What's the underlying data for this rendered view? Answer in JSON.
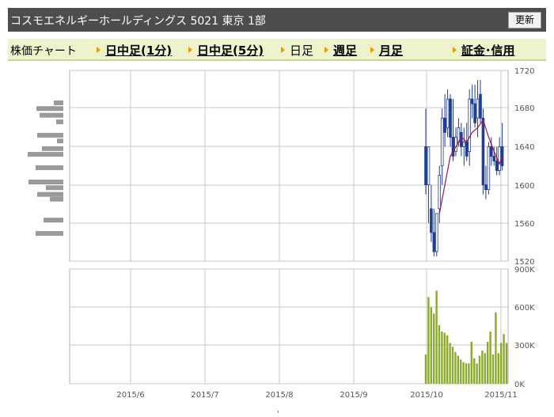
{
  "header": {
    "title": "コスモエネルギーホールディングス 5021 東京 1部",
    "refresh_label": "更新"
  },
  "nav": {
    "label": "株価チャート",
    "items": [
      {
        "label": "日中足(1分)",
        "link": true
      },
      {
        "label": "日中足(5分)",
        "link": true
      },
      {
        "label": "日足",
        "link": false
      },
      {
        "label": "週足",
        "link": true
      },
      {
        "label": "月足",
        "link": true
      },
      {
        "label": "証金･信用",
        "link": true
      }
    ]
  },
  "colors": {
    "candle": "#1f3c99",
    "moving_average": "#a0174f",
    "volume": "#8cab2d",
    "volume_profile": "#9a9a9a",
    "grid": "#c8c8c8"
  },
  "chart_data": [
    {
      "type": "candlestick",
      "x_ticks": [
        "2015/6",
        "2015/7",
        "2015/8",
        "2015/9",
        "2015/10",
        "2015/11"
      ],
      "y_ticks": [
        "1720",
        "1680",
        "1640",
        "1600",
        "1560",
        "1520"
      ],
      "ylim": [
        1520,
        1720
      ],
      "candles": [
        {
          "o": 1640,
          "h": 1680,
          "l": 1590,
          "c": 1600
        },
        {
          "o": 1600,
          "h": 1640,
          "l": 1560,
          "c": 1640
        },
        {
          "o": 1575,
          "h": 1600,
          "l": 1540,
          "c": 1550
        },
        {
          "o": 1550,
          "h": 1575,
          "l": 1525,
          "c": 1530
        },
        {
          "o": 1530,
          "h": 1570,
          "l": 1525,
          "c": 1570
        },
        {
          "o": 1575,
          "h": 1620,
          "l": 1560,
          "c": 1610
        },
        {
          "o": 1620,
          "h": 1680,
          "l": 1600,
          "c": 1670
        },
        {
          "o": 1670,
          "h": 1695,
          "l": 1640,
          "c": 1655
        },
        {
          "o": 1660,
          "h": 1700,
          "l": 1650,
          "c": 1690
        },
        {
          "o": 1690,
          "h": 1695,
          "l": 1640,
          "c": 1650
        },
        {
          "o": 1650,
          "h": 1690,
          "l": 1625,
          "c": 1630
        },
        {
          "o": 1635,
          "h": 1660,
          "l": 1630,
          "c": 1650
        },
        {
          "o": 1645,
          "h": 1670,
          "l": 1640,
          "c": 1660
        },
        {
          "o": 1655,
          "h": 1665,
          "l": 1630,
          "c": 1640
        },
        {
          "o": 1640,
          "h": 1660,
          "l": 1620,
          "c": 1645
        },
        {
          "o": 1645,
          "h": 1665,
          "l": 1625,
          "c": 1630
        },
        {
          "o": 1635,
          "h": 1700,
          "l": 1620,
          "c": 1690
        },
        {
          "o": 1690,
          "h": 1705,
          "l": 1670,
          "c": 1685
        },
        {
          "o": 1685,
          "h": 1705,
          "l": 1660,
          "c": 1665
        },
        {
          "o": 1670,
          "h": 1710,
          "l": 1650,
          "c": 1690
        },
        {
          "o": 1695,
          "h": 1710,
          "l": 1665,
          "c": 1670
        },
        {
          "o": 1670,
          "h": 1680,
          "l": 1590,
          "c": 1600
        },
        {
          "o": 1600,
          "h": 1620,
          "l": 1585,
          "c": 1595
        },
        {
          "o": 1595,
          "h": 1645,
          "l": 1590,
          "c": 1640
        },
        {
          "o": 1640,
          "h": 1650,
          "l": 1620,
          "c": 1630
        },
        {
          "o": 1630,
          "h": 1640,
          "l": 1620,
          "c": 1625
        },
        {
          "o": 1625,
          "h": 1640,
          "l": 1610,
          "c": 1615
        },
        {
          "o": 1615,
          "h": 1650,
          "l": 1610,
          "c": 1640
        },
        {
          "o": 1640,
          "h": 1665,
          "l": 1615,
          "c": 1620
        }
      ],
      "moving_average": [
        {
          "i": 5,
          "v": 1570
        },
        {
          "i": 7,
          "v": 1600
        },
        {
          "i": 9,
          "v": 1630
        },
        {
          "i": 11,
          "v": 1640
        },
        {
          "i": 13,
          "v": 1650
        },
        {
          "i": 15,
          "v": 1645
        },
        {
          "i": 17,
          "v": 1655
        },
        {
          "i": 19,
          "v": 1660
        },
        {
          "i": 21,
          "v": 1668
        },
        {
          "i": 23,
          "v": 1650
        },
        {
          "i": 25,
          "v": 1635
        },
        {
          "i": 27,
          "v": 1622
        },
        {
          "i": 28,
          "v": 1630
        }
      ],
      "volume_profile": [
        {
          "price": 1686,
          "width": 12
        },
        {
          "price": 1680,
          "width": 34
        },
        {
          "price": 1673,
          "width": 30
        },
        {
          "price": 1666,
          "width": 9
        },
        {
          "price": 1652,
          "width": 33
        },
        {
          "price": 1646,
          "width": 8
        },
        {
          "price": 1638,
          "width": 27
        },
        {
          "price": 1632,
          "width": 45
        },
        {
          "price": 1618,
          "width": 35
        },
        {
          "price": 1603,
          "width": 44
        },
        {
          "price": 1597,
          "width": 22
        },
        {
          "price": 1590,
          "width": 33
        },
        {
          "price": 1585,
          "width": 17
        },
        {
          "price": 1563,
          "width": 25
        },
        {
          "price": 1549,
          "width": 35
        }
      ]
    },
    {
      "type": "bar",
      "name": "volume",
      "y_ticks": [
        "900K",
        "600K",
        "300K",
        "0K"
      ],
      "ylim": [
        0,
        900000
      ],
      "values": [
        230000,
        680000,
        600000,
        550000,
        730000,
        460000,
        410000,
        400000,
        380000,
        320000,
        290000,
        250000,
        220000,
        190000,
        170000,
        160000,
        160000,
        330000,
        200000,
        160000,
        220000,
        260000,
        240000,
        330000,
        410000,
        230000,
        560000,
        240000,
        320000,
        390000,
        320000
      ]
    }
  ]
}
